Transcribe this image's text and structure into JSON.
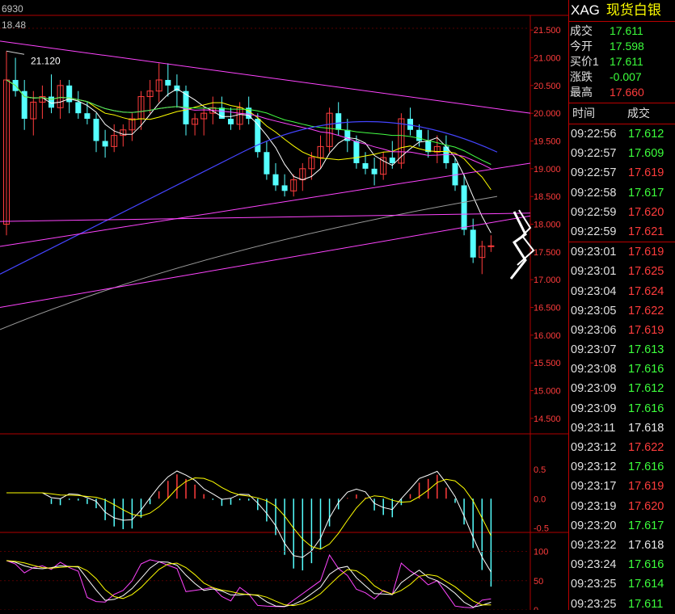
{
  "header": {
    "top_value": "6930",
    "second_value": "18.48"
  },
  "colors": {
    "up": "#ff3c3c",
    "down": "#55ffff",
    "grid": "#b00000",
    "ma5": "#ffffff",
    "ma10": "#ffff00",
    "ma20": "#ff44ff",
    "ma30": "#44ff44",
    "ma60": "#4444ff",
    "ma_long": "#999999"
  },
  "chart_data": [
    {
      "type": "candlestick",
      "annotations": [
        "21.120"
      ],
      "y_ticks": [
        "21.500",
        "21.000",
        "20.500",
        "20.000",
        "19.500",
        "19.000",
        "18.500",
        "18.000",
        "17.500",
        "17.000",
        "16.500",
        "16.000",
        "15.500",
        "15.000",
        "14.500"
      ],
      "ylim": [
        14.25,
        21.75
      ],
      "candles": [
        [
          18.0,
          21.12,
          17.8,
          20.6
        ],
        [
          20.6,
          21.0,
          20.3,
          20.4
        ],
        [
          20.4,
          20.6,
          19.7,
          19.9
        ],
        [
          19.9,
          20.4,
          19.6,
          20.2
        ],
        [
          20.2,
          20.5,
          19.9,
          20.3
        ],
        [
          20.3,
          20.7,
          20.0,
          20.1
        ],
        [
          20.1,
          20.6,
          19.9,
          20.5
        ],
        [
          20.5,
          20.6,
          20.0,
          20.2
        ],
        [
          20.2,
          20.4,
          19.9,
          20.0
        ],
        [
          20.0,
          20.2,
          19.8,
          19.9
        ],
        [
          19.9,
          20.0,
          19.3,
          19.5
        ],
        [
          19.5,
          19.7,
          19.2,
          19.4
        ],
        [
          19.4,
          19.8,
          19.3,
          19.6
        ],
        [
          19.6,
          19.8,
          19.4,
          19.7
        ],
        [
          19.7,
          20.0,
          19.5,
          19.9
        ],
        [
          19.9,
          20.4,
          19.7,
          20.3
        ],
        [
          20.3,
          20.6,
          20.0,
          20.4
        ],
        [
          20.4,
          20.9,
          20.2,
          20.6
        ],
        [
          20.6,
          20.9,
          20.3,
          20.5
        ],
        [
          20.5,
          20.7,
          20.1,
          20.4
        ],
        [
          20.4,
          20.5,
          19.6,
          19.8
        ],
        [
          19.8,
          20.0,
          19.6,
          19.9
        ],
        [
          19.9,
          20.1,
          19.6,
          20.0
        ],
        [
          20.0,
          20.3,
          19.8,
          20.1
        ],
        [
          20.1,
          20.3,
          19.9,
          19.9
        ],
        [
          19.9,
          20.1,
          19.7,
          19.8
        ],
        [
          19.8,
          20.2,
          19.7,
          20.1
        ],
        [
          20.1,
          20.3,
          19.8,
          19.9
        ],
        [
          19.9,
          20.0,
          19.2,
          19.3
        ],
        [
          19.3,
          19.5,
          18.8,
          18.9
        ],
        [
          18.9,
          19.1,
          18.6,
          18.7
        ],
        [
          18.7,
          18.9,
          18.5,
          18.6
        ],
        [
          18.6,
          18.9,
          18.5,
          18.8
        ],
        [
          18.8,
          19.1,
          18.6,
          19.0
        ],
        [
          19.0,
          19.3,
          18.8,
          19.2
        ],
        [
          19.2,
          19.6,
          19.0,
          19.4
        ],
        [
          19.4,
          20.1,
          19.3,
          20.0
        ],
        [
          20.0,
          20.2,
          19.6,
          19.7
        ],
        [
          19.7,
          19.9,
          19.3,
          19.5
        ],
        [
          19.5,
          19.6,
          19.0,
          19.1
        ],
        [
          19.1,
          19.3,
          18.9,
          19.0
        ],
        [
          19.0,
          19.2,
          18.7,
          18.9
        ],
        [
          18.9,
          19.3,
          18.8,
          19.2
        ],
        [
          19.2,
          19.5,
          19.0,
          19.1
        ],
        [
          19.1,
          20.0,
          19.0,
          19.9
        ],
        [
          19.9,
          20.1,
          19.6,
          19.7
        ],
        [
          19.7,
          19.8,
          19.4,
          19.5
        ],
        [
          19.5,
          19.7,
          19.2,
          19.3
        ],
        [
          19.3,
          19.6,
          19.1,
          19.4
        ],
        [
          19.4,
          19.6,
          19.0,
          19.1
        ],
        [
          19.1,
          19.2,
          18.6,
          18.7
        ],
        [
          18.7,
          18.9,
          17.8,
          17.9
        ],
        [
          17.9,
          18.1,
          17.3,
          17.4
        ],
        [
          17.4,
          17.7,
          17.1,
          17.6
        ],
        [
          17.6,
          17.8,
          17.5,
          17.61
        ]
      ]
    },
    {
      "type": "bar",
      "y_ticks": [
        "0.5",
        "0.0",
        "-0.5"
      ],
      "ylim": [
        -0.55,
        1.0
      ]
    },
    {
      "type": "line",
      "y_ticks": [
        "100",
        "50",
        "0"
      ],
      "ylim": [
        0,
        120
      ]
    }
  ],
  "right_panel": {
    "symbol": "XAG",
    "name": "现货白银",
    "quotes": [
      {
        "label": "成交",
        "value": "17.611",
        "color": "green"
      },
      {
        "label": "今开",
        "value": "17.598",
        "color": "green"
      },
      {
        "label": "买价1",
        "value": "17.611",
        "color": "green"
      },
      {
        "label": "涨跌",
        "value": "-0.007",
        "color": "green"
      },
      {
        "label": "最高",
        "value": "17.660",
        "color": "red"
      }
    ],
    "ticks_header": {
      "time": "时间",
      "price": "成交"
    },
    "ticks": [
      {
        "time": "09:22:56",
        "price": "17.612",
        "color": "green"
      },
      {
        "time": "09:22:57",
        "price": "17.609",
        "color": "green"
      },
      {
        "time": "09:22:57",
        "price": "17.619",
        "color": "red"
      },
      {
        "time": "09:22:58",
        "price": "17.617",
        "color": "green"
      },
      {
        "time": "09:22:59",
        "price": "17.620",
        "color": "red"
      },
      {
        "time": "09:22:59",
        "price": "17.621",
        "color": "red"
      },
      {
        "time": "09:23:01",
        "price": "17.619",
        "color": "red"
      },
      {
        "time": "09:23:01",
        "price": "17.625",
        "color": "red"
      },
      {
        "time": "09:23:04",
        "price": "17.624",
        "color": "red"
      },
      {
        "time": "09:23:05",
        "price": "17.622",
        "color": "red"
      },
      {
        "time": "09:23:06",
        "price": "17.619",
        "color": "red"
      },
      {
        "time": "09:23:07",
        "price": "17.613",
        "color": "green"
      },
      {
        "time": "09:23:08",
        "price": "17.616",
        "color": "green"
      },
      {
        "time": "09:23:09",
        "price": "17.612",
        "color": "green"
      },
      {
        "time": "09:23:09",
        "price": "17.616",
        "color": "green"
      },
      {
        "time": "09:23:11",
        "price": "17.618",
        "color": "white"
      },
      {
        "time": "09:23:12",
        "price": "17.622",
        "color": "red"
      },
      {
        "time": "09:23:12",
        "price": "17.616",
        "color": "green"
      },
      {
        "time": "09:23:17",
        "price": "17.619",
        "color": "red"
      },
      {
        "time": "09:23:19",
        "price": "17.620",
        "color": "red"
      },
      {
        "time": "09:23:20",
        "price": "17.617",
        "color": "green"
      },
      {
        "time": "09:23:22",
        "price": "17.618",
        "color": "white"
      },
      {
        "time": "09:23:24",
        "price": "17.616",
        "color": "green"
      },
      {
        "time": "09:23:25",
        "price": "17.614",
        "color": "green"
      },
      {
        "time": "09:23:25",
        "price": "17.611",
        "color": "green"
      }
    ]
  }
}
